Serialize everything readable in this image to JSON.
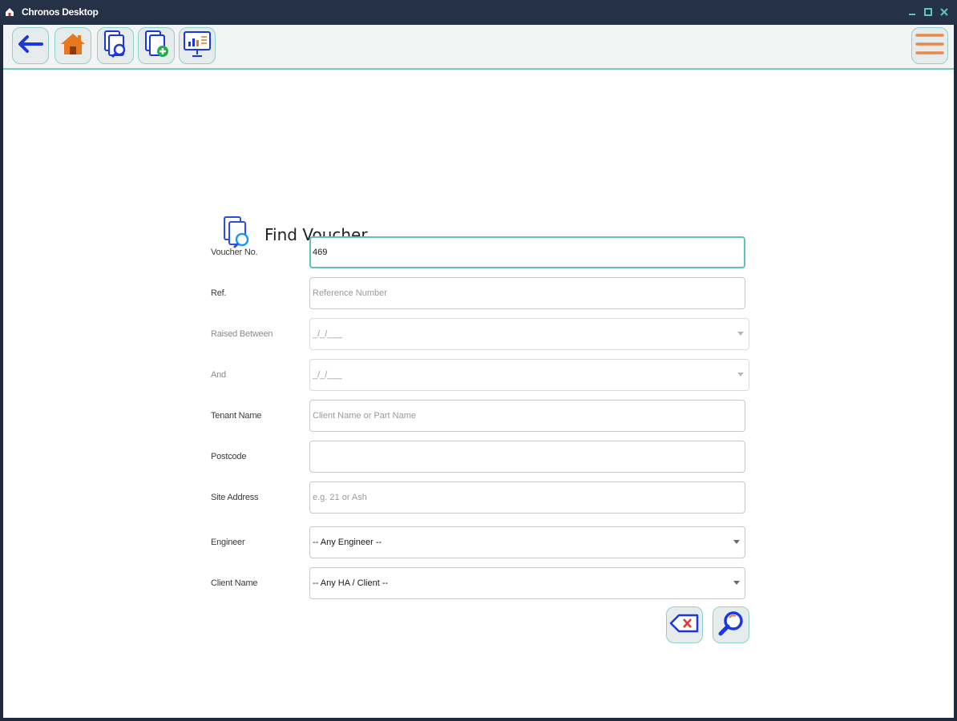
{
  "window": {
    "title": "Chronos Desktop"
  },
  "toolbar": {
    "back_icon": "arrow-left-icon",
    "home_icon": "home-icon",
    "find_voucher_icon": "document-search-icon",
    "new_voucher_icon": "document-add-icon",
    "reports_icon": "presentation-chart-icon",
    "menu_icon": "hamburger-menu-icon"
  },
  "form": {
    "title": "Find Voucher",
    "fields": {
      "voucher_no": {
        "label": "Voucher No.",
        "value": "469"
      },
      "ref": {
        "label": "Ref.",
        "placeholder": "Reference Number"
      },
      "raised_between": {
        "label": "Raised Between",
        "value": "_/_/___"
      },
      "and": {
        "label": "And",
        "value": "_/_/___"
      },
      "tenant_name": {
        "label": "Tenant Name",
        "placeholder": "Client Name or Part Name"
      },
      "postcode": {
        "label": "Postcode",
        "value": ""
      },
      "site_address": {
        "label": "Site Address",
        "placeholder": "e.g. 21 or Ash"
      },
      "engineer": {
        "label": "Engineer",
        "value": "-- Any Engineer --"
      },
      "client_name": {
        "label": "Client Name",
        "value": "-- Any HA / Client --"
      }
    },
    "buttons": {
      "clear_icon": "backspace-clear-icon",
      "search_icon": "magnifier-search-icon"
    }
  },
  "colors": {
    "titlebar": "#243147",
    "accent": "#60c2b6",
    "toolbar_bg": "#f3f5f5"
  }
}
